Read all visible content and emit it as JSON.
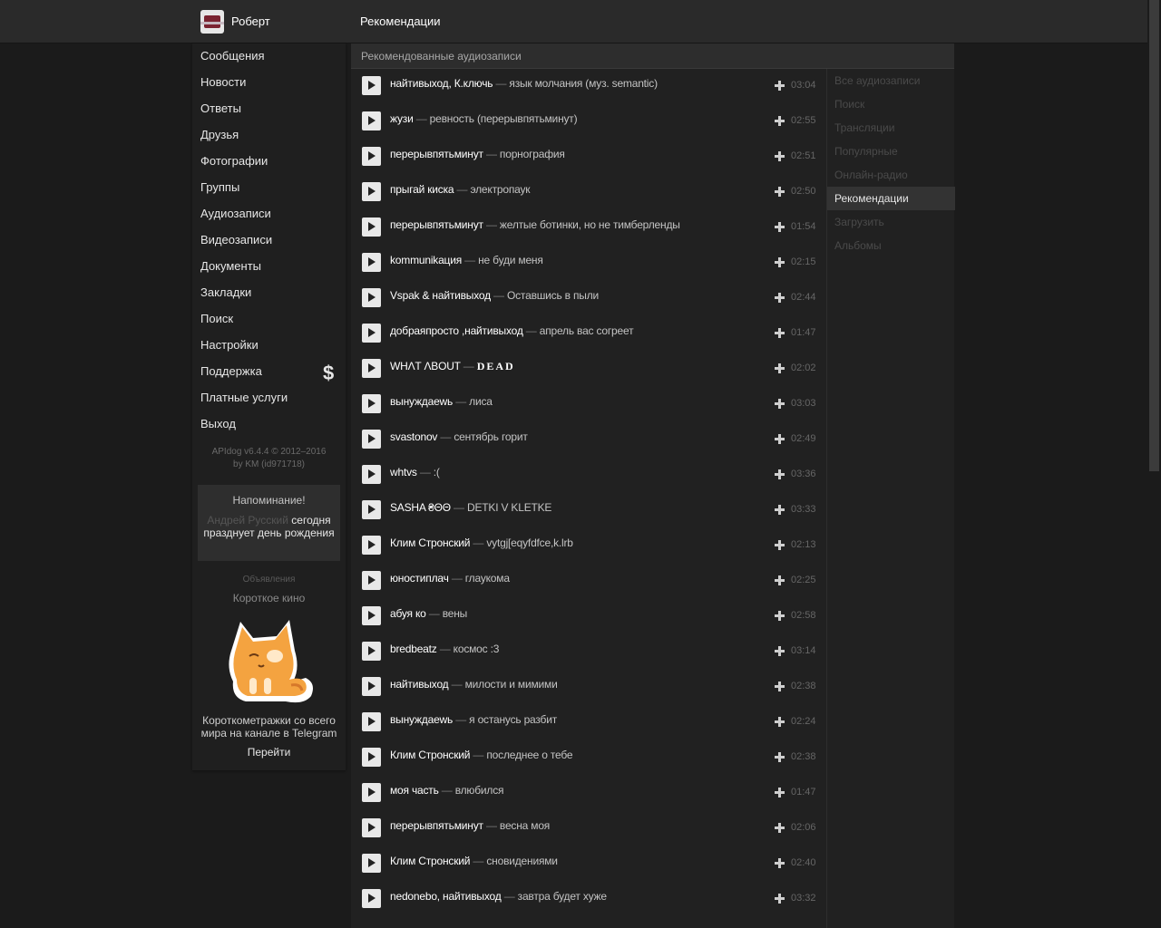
{
  "header": {
    "user_name": "Роберт",
    "page_title": "Рекомендации"
  },
  "sidebar": {
    "items": [
      {
        "label": "Сообщения"
      },
      {
        "label": "Новости"
      },
      {
        "label": "Ответы"
      },
      {
        "label": "Друзья"
      },
      {
        "label": "Фотографии"
      },
      {
        "label": "Группы"
      },
      {
        "label": "Аудиозаписи"
      },
      {
        "label": "Видеозаписи"
      },
      {
        "label": "Документы"
      },
      {
        "label": "Закладки"
      },
      {
        "label": "Поиск"
      },
      {
        "label": "Настройки"
      },
      {
        "label": "Поддержка"
      },
      {
        "label": "Платные услуги"
      },
      {
        "label": "Выход"
      }
    ],
    "support_badge": "$",
    "copyright_line1": "APIdog v6.4.4 © 2012–2016",
    "copyright_line2": "by KM (id971718)",
    "reminder": {
      "title": "Напоминание!",
      "who": "Андрей Русский",
      "text": "сегодня празднует день рождения"
    },
    "ads": {
      "label": "Объявления",
      "title": "Короткое кино",
      "text": "Короткометражки со всего мира на канале в Telegram",
      "go": "Перейти"
    }
  },
  "main": {
    "section_title": "Рекомендованные аудиозаписи",
    "tracks": [
      {
        "artist": "найтивыход, К.ключь",
        "title": "язык молчания (муз. semantic)",
        "duration": "03:04"
      },
      {
        "artist": "жузи",
        "title": "ревность (перерывпятьминут)",
        "duration": "02:55"
      },
      {
        "artist": "перерывпятьминут",
        "title": "порнография",
        "duration": "02:51"
      },
      {
        "artist": "прыгай киска",
        "title": "электропаук",
        "duration": "02:50"
      },
      {
        "artist": "перерывпятьминут",
        "title": "желтые ботинки, но не тимберленды",
        "duration": "01:54"
      },
      {
        "artist": "kommunikация",
        "title": "не буди меня",
        "duration": "02:15"
      },
      {
        "artist": "Vspak & найтивыход",
        "title": "Оставшись в пыли",
        "duration": "02:44"
      },
      {
        "artist": "добраяпросто ,найтивыход",
        "title": "апрель вас согреет",
        "duration": "01:47"
      },
      {
        "artist": "WHΛT ΛBOUT",
        "title": "DEAD",
        "duration": "02:02"
      },
      {
        "artist": "вынуждаеwь",
        "title": "лиса",
        "duration": "03:03"
      },
      {
        "artist": "svastonov",
        "title": "сентябрь горит",
        "duration": "02:49"
      },
      {
        "artist": "whtvs",
        "title": ":(",
        "duration": "03:36"
      },
      {
        "artist": "SASHA ₴ΘΘ",
        "title": "DETKI V KLETKE",
        "duration": "03:33"
      },
      {
        "artist": "Клим Стронский",
        "title": "vytgj[eqyfdfce,k.lrb",
        "duration": "02:13"
      },
      {
        "artist": "юностиплач",
        "title": "глаукома",
        "duration": "02:25"
      },
      {
        "artist": "абуя ко",
        "title": "вены",
        "duration": "02:58"
      },
      {
        "artist": "bredbeatz",
        "title": "космос :3",
        "duration": "03:14"
      },
      {
        "artist": "найтивыход",
        "title": "милости и мимими",
        "duration": "02:38"
      },
      {
        "artist": "вынуждаеwь",
        "title": "я останусь разбит",
        "duration": "02:24"
      },
      {
        "artist": "Клим Стронский",
        "title": "последнее о тебе",
        "duration": "02:38"
      },
      {
        "artist": "моя часть",
        "title": "влюбился",
        "duration": "01:47"
      },
      {
        "artist": "перерывпятьминут",
        "title": "весна моя",
        "duration": "02:06"
      },
      {
        "artist": "Клим Стронский",
        "title": "сновидениями",
        "duration": "02:40"
      },
      {
        "artist": "nedonebo, найтивыход",
        "title": "завтра будет хуже",
        "duration": "03:32"
      }
    ],
    "separator": "—"
  },
  "right_menu": {
    "items": [
      {
        "label": "Все аудиозаписи"
      },
      {
        "label": "Поиск"
      },
      {
        "label": "Трансляции"
      },
      {
        "label": "Популярные"
      },
      {
        "label": "Онлайн-радио"
      },
      {
        "label": "Рекомендации"
      },
      {
        "label": "Загрузить"
      },
      {
        "label": "Альбомы"
      }
    ]
  }
}
